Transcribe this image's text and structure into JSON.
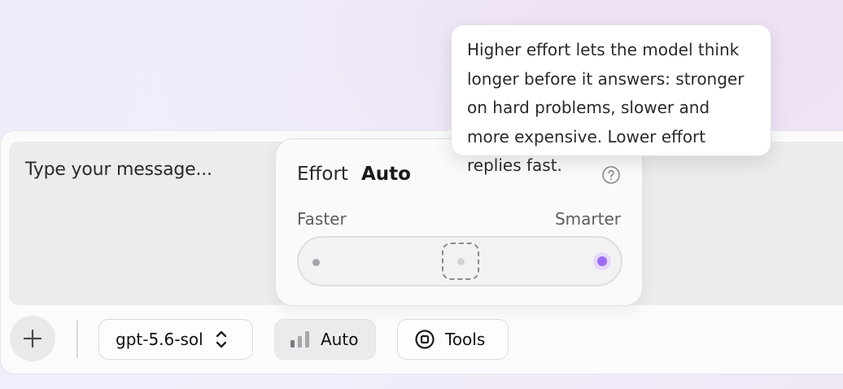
{
  "composer": {
    "placeholder": "Type your message..."
  },
  "toolbar": {
    "add_icon": "plus-icon",
    "model_label": "gpt-5.6-sol",
    "model_icon": "chevron-up-down-icon",
    "effort_label": "Auto",
    "effort_icon": "signal-bars-icon",
    "tools_label": "Tools",
    "tools_icon": "tools-icon"
  },
  "effort_panel": {
    "title": "Effort",
    "value": "Auto",
    "help_icon": "question-circle-icon",
    "left_label": "Faster",
    "right_label": "Smarter",
    "stops": 3,
    "selected_stop_index": 1,
    "active_color": "#9b6cf3"
  },
  "tooltip": {
    "text": "Higher effort lets the model think longer before it answers: stronger on hard problems, slower and more expensive. Lower effort replies fast."
  }
}
